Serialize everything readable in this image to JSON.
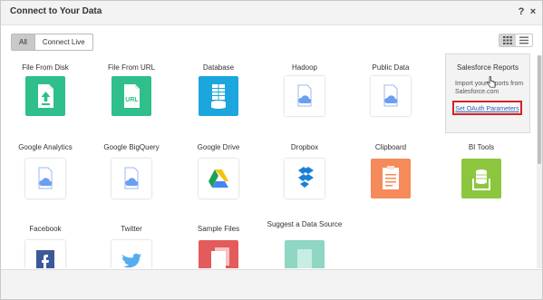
{
  "dialog": {
    "title": "Connect to Your Data",
    "help": "?",
    "close": "×"
  },
  "toolbar": {
    "filters": [
      "All",
      "Connect Live"
    ],
    "active_filter": "All"
  },
  "tiles": [
    {
      "label": "File From Disk"
    },
    {
      "label": "File From URL",
      "icon_text": "URL"
    },
    {
      "label": "Database"
    },
    {
      "label": "Hadoop"
    },
    {
      "label": "Public Data"
    },
    {
      "label": "Google Analytics"
    },
    {
      "label": "Google BigQuery"
    },
    {
      "label": "Google Drive"
    },
    {
      "label": "Dropbox"
    },
    {
      "label": "Clipboard"
    },
    {
      "label": "BI Tools"
    },
    {
      "label": "Facebook"
    },
    {
      "label": "Twitter"
    },
    {
      "label": "Sample Files"
    },
    {
      "label": "Suggest a Data Source"
    }
  ],
  "salesforce": {
    "title": "Salesforce Reports",
    "description": "Import your reports from Salesforce.com",
    "link": "Set OAuth Parameters"
  },
  "colors": {
    "green": "#2fbf8b",
    "blue": "#1ca6de",
    "orange": "#f58a5a",
    "lime": "#8cc63f",
    "facebook": "#3b5998",
    "red": "#e35b5b",
    "teal": "#8fd6c4",
    "cloud": "#6c9ef0"
  }
}
